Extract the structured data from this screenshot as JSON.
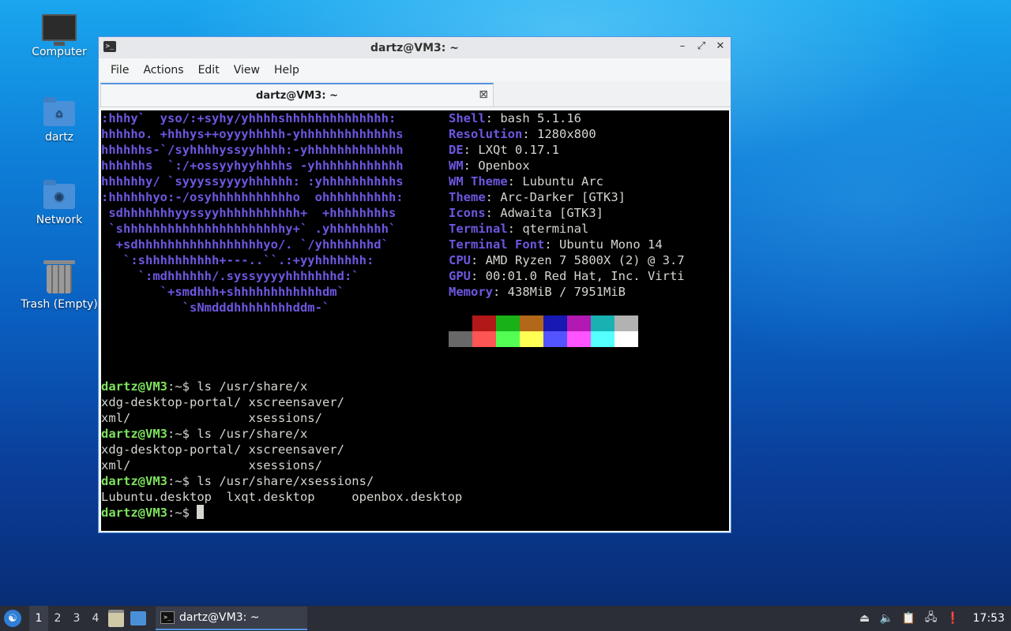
{
  "desktop": {
    "icons": [
      {
        "label": "Computer"
      },
      {
        "label": "dartz"
      },
      {
        "label": "Network"
      },
      {
        "label": "Trash (Empty)"
      }
    ]
  },
  "window": {
    "title": "dartz@VM3: ~",
    "controls": {
      "minimize": "–",
      "maximize": "⤢",
      "close": "✕"
    },
    "menu": [
      "File",
      "Actions",
      "Edit",
      "View",
      "Help"
    ],
    "tab": {
      "label": "dartz@VM3: ~",
      "close": "⊠"
    }
  },
  "terminal": {
    "ascii": [
      ":hhhy`  yso/:+syhy/yhhhhshhhhhhhhhhhhhh:",
      "hhhhho. +hhhys++oyyyhhhhh-yhhhhhhhhhhhhhs",
      "hhhhhhs-`/syhhhhyssyyhhhh:-yhhhhhhhhhhhhh",
      "hhhhhhs  `:/+ossyyhyyhhhhs -yhhhhhhhhhhhh",
      "hhhhhhy/ `syyyssyyyyhhhhhh: :yhhhhhhhhhhs",
      ":hhhhhhyo:-/osyhhhhhhhhhhho  ohhhhhhhhhh:",
      " sdhhhhhhhyyssyyhhhhhhhhhhh+  +hhhhhhhhs",
      " `shhhhhhhhhhhhhhhhhhhhhhy+` .yhhhhhhhh`",
      "  +sdhhhhhhhhhhhhhhhhhyo/. `/yhhhhhhhd`",
      "   `:shhhhhhhhhh+---..``.:+yyhhhhhhh:",
      "     `:mdhhhhhh/.syssyyyyhhhhhhhd:`",
      "        `+smdhhh+shhhhhhhhhhhhdm`",
      "           `sNmdddhhhhhhhhddm-`"
    ],
    "info": [
      {
        "key": "Shell",
        "value": "bash 5.1.16"
      },
      {
        "key": "Resolution",
        "value": "1280x800"
      },
      {
        "key": "DE",
        "value": "LXQt 0.17.1"
      },
      {
        "key": "WM",
        "value": "Openbox"
      },
      {
        "key": "WM Theme",
        "value": "Lubuntu Arc"
      },
      {
        "key": "Theme",
        "value": "Arc-Darker [GTK3]"
      },
      {
        "key": "Icons",
        "value": "Adwaita [GTK3]"
      },
      {
        "key": "Terminal",
        "value": "qterminal"
      },
      {
        "key": "Terminal Font",
        "value": "Ubuntu Mono 14"
      },
      {
        "key": "CPU",
        "value": "AMD Ryzen 7 5800X (2) @ 3.7"
      },
      {
        "key": "GPU",
        "value": "00:01.0 Red Hat, Inc. Virti"
      },
      {
        "key": "Memory",
        "value": "438MiB / 7951MiB"
      }
    ],
    "palette_row1": [
      "#000000",
      "#b21818",
      "#18b218",
      "#b26818",
      "#1818b2",
      "#b218b2",
      "#18b2b2",
      "#b2b2b2"
    ],
    "palette_row2": [
      "#686868",
      "#ff5454",
      "#54ff54",
      "#ffff54",
      "#5454ff",
      "#ff54ff",
      "#54ffff",
      "#ffffff"
    ],
    "prompt": "dartz@VM3",
    "lines": [
      {
        "type": "cmd",
        "path": "~",
        "command": "ls /usr/share/x"
      },
      {
        "type": "out",
        "text": "xdg-desktop-portal/ xscreensaver/"
      },
      {
        "type": "out",
        "text": "xml/                xsessions/"
      },
      {
        "type": "cmd",
        "path": "~",
        "command": "ls /usr/share/x"
      },
      {
        "type": "out",
        "text": "xdg-desktop-portal/ xscreensaver/"
      },
      {
        "type": "out",
        "text": "xml/                xsessions/"
      },
      {
        "type": "cmd",
        "path": "~",
        "command": "ls /usr/share/xsessions/"
      },
      {
        "type": "out",
        "text": "Lubuntu.desktop  lxqt.desktop     openbox.desktop"
      },
      {
        "type": "cmd",
        "path": "~",
        "command": ""
      }
    ]
  },
  "taskbar": {
    "desktops": [
      "1",
      "2",
      "3",
      "4"
    ],
    "active_desktop": "1",
    "task_label": "dartz@VM3: ~",
    "clock": "17:53"
  }
}
